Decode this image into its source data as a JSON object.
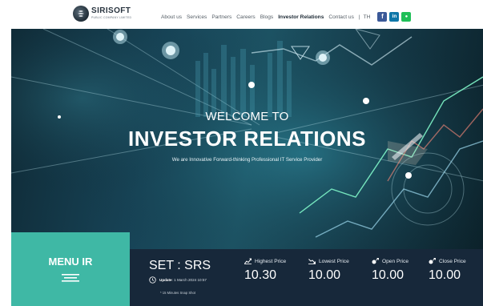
{
  "brand": {
    "name": "SIRISOFT",
    "tagline": "PUBLIC COMPANY LIMITED"
  },
  "nav": {
    "items": [
      {
        "label": "About us"
      },
      {
        "label": "Services"
      },
      {
        "label": "Partners"
      },
      {
        "label": "Careers"
      },
      {
        "label": "Blogs"
      },
      {
        "label": "Investor Relations",
        "active": true
      },
      {
        "label": "Contact us"
      }
    ],
    "separator": "|",
    "language": "TH",
    "social": [
      {
        "icon": "facebook-icon",
        "glyph": "f",
        "color": "#3b5998"
      },
      {
        "icon": "linkedin-icon",
        "glyph": "in",
        "color": "#0e76a8"
      },
      {
        "icon": "line-icon",
        "glyph": "●",
        "color": "#1fbf58"
      }
    ]
  },
  "hero": {
    "title_small": "WELCOME TO",
    "title_big": "INVESTOR RELATIONS",
    "subtitle": "We are Innovative Forward-thinking Professional IT Service Provider"
  },
  "menu_ir": {
    "label": "MENU IR",
    "icon": "hamburger-icon",
    "color": "#3fb8a5"
  },
  "stock": {
    "symbol": "SET : SRS",
    "update_label": "Update",
    "update_value": ": 1 March 2024 10:57",
    "snapshot_note": "* 15 Minutes Snap Shot",
    "panel_color": "#17283a",
    "prices": [
      {
        "label": "Highest Price",
        "value": "10.30",
        "icon": "price-high-icon"
      },
      {
        "label": "Lowest Price",
        "value": "10.00",
        "icon": "price-low-icon"
      },
      {
        "label": "Open Price",
        "value": "10.00",
        "icon": "price-open-icon"
      },
      {
        "label": "Close Price",
        "value": "10.00",
        "icon": "price-close-icon"
      }
    ]
  }
}
